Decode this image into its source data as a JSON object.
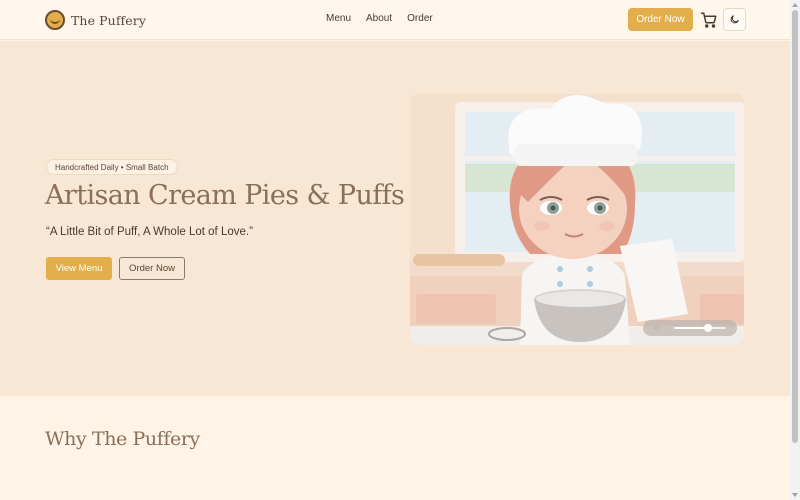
{
  "header": {
    "brand": "The Puffery",
    "nav": [
      {
        "label": "Menu"
      },
      {
        "label": "About"
      },
      {
        "label": "Order"
      }
    ],
    "order_button": "Order Now",
    "icons": {
      "cart": "cart-icon",
      "theme": "moon-icon",
      "logo": "smiley-logo-icon"
    }
  },
  "hero": {
    "badge": "Handcrafted Daily • Small Batch",
    "title": "Artisan Cream Pies & Puffs",
    "tagline": "“A Little Bit of Puff, A Whole Lot of Love.”",
    "primary_button": "View Menu",
    "secondary_button": "Order Now",
    "media": {
      "muted": true,
      "volume": 0.65
    }
  },
  "why": {
    "title": "Why The Puffery"
  },
  "colors": {
    "accent": "#e2ad4b",
    "hero_bg": "#f8e7d4",
    "heading": "#8a6f5a",
    "text": "#4a3a2e"
  }
}
